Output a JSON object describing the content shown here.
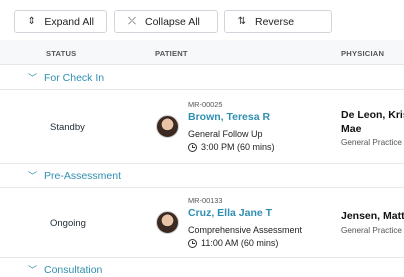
{
  "toolbar": {
    "expand_all": "Expand All",
    "collapse_all": "Collapse All",
    "reverse": "Reverse"
  },
  "table": {
    "columns": {
      "status": "STATUS",
      "patient": "PATIENT",
      "physician": "PHYSICIAN"
    }
  },
  "groups": [
    {
      "label": "For Check In",
      "rows": [
        {
          "status": "Standby",
          "mr": "MR-00025",
          "patient_name": "Brown, Teresa R",
          "appointment_type": "General Follow Up",
          "time": "3:00 PM (60 mins)",
          "physician_line1": "De Leon, Kristi",
          "physician_line2": "Mae",
          "specialty": "General Practice"
        }
      ]
    },
    {
      "label": "Pre-Assessment",
      "rows": [
        {
          "status": "Ongoing",
          "mr": "MR-00133",
          "patient_name": "Cruz, Ella Jane T",
          "appointment_type": "Comprehensive Assessment",
          "time": "11:00 AM (60 mins)",
          "physician_line1": "Jensen, Matth",
          "specialty": "General Practice"
        }
      ]
    },
    {
      "label": "Consultation",
      "rows": []
    }
  ]
}
